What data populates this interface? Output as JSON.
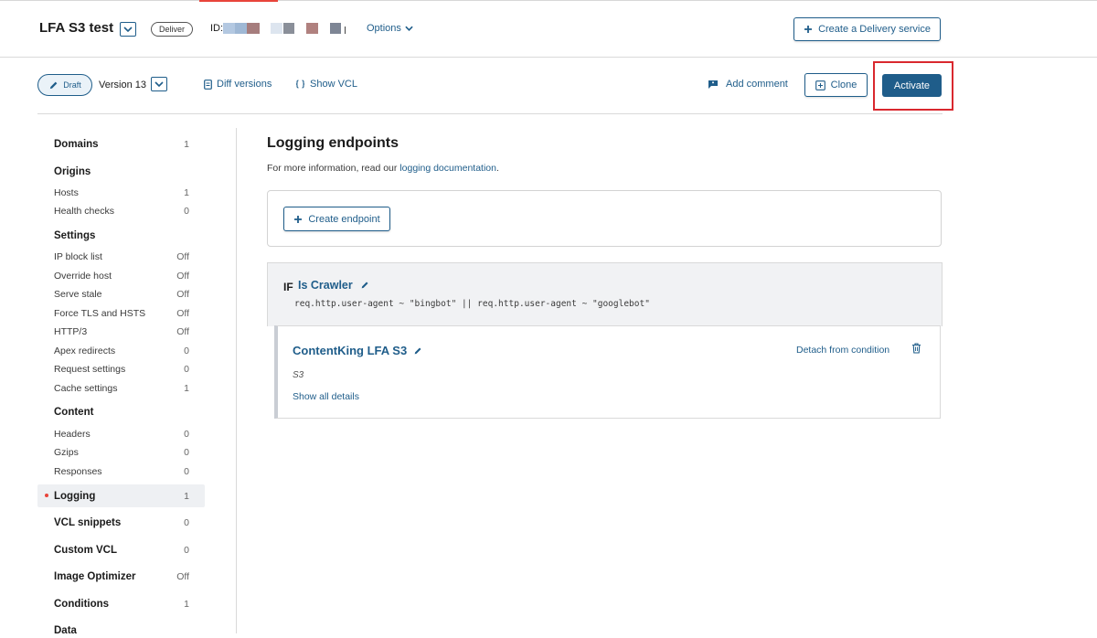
{
  "header": {
    "service_name": "LFA S3 test",
    "service_badge": "Deliver",
    "id_label": "ID:",
    "options_label": "Options",
    "create_service_label": "Create a Delivery service"
  },
  "version_bar": {
    "status_label": "Draft",
    "version_label": "Version 13",
    "diff_label": "Diff versions",
    "show_vcl_label": "Show VCL",
    "add_comment_label": "Add comment",
    "clone_label": "Clone",
    "activate_label": "Activate"
  },
  "sidebar": {
    "domains": {
      "label": "Domains",
      "value": "1"
    },
    "origins": {
      "label": "Origins"
    },
    "hosts": {
      "label": "Hosts",
      "value": "1"
    },
    "health_checks": {
      "label": "Health checks",
      "value": "0"
    },
    "settings": {
      "label": "Settings"
    },
    "ip_block_list": {
      "label": "IP block list",
      "value": "Off"
    },
    "override_host": {
      "label": "Override host",
      "value": "Off"
    },
    "serve_stale": {
      "label": "Serve stale",
      "value": "Off"
    },
    "force_tls": {
      "label": "Force TLS and HSTS",
      "value": "Off"
    },
    "http3": {
      "label": "HTTP/3",
      "value": "Off"
    },
    "apex_redirects": {
      "label": "Apex redirects",
      "value": "0"
    },
    "request_settings": {
      "label": "Request settings",
      "value": "0"
    },
    "cache_settings": {
      "label": "Cache settings",
      "value": "1"
    },
    "content": {
      "label": "Content"
    },
    "headers": {
      "label": "Headers",
      "value": "0"
    },
    "gzips": {
      "label": "Gzips",
      "value": "0"
    },
    "responses": {
      "label": "Responses",
      "value": "0"
    },
    "logging": {
      "label": "Logging",
      "value": "1"
    },
    "vcl_snippets": {
      "label": "VCL snippets",
      "value": "0"
    },
    "custom_vcl": {
      "label": "Custom VCL",
      "value": "0"
    },
    "image_optimizer": {
      "label": "Image Optimizer",
      "value": "Off"
    },
    "conditions": {
      "label": "Conditions",
      "value": "1"
    },
    "data": {
      "label": "Data"
    }
  },
  "main": {
    "title": "Logging endpoints",
    "info_prefix": "For more information, read our ",
    "info_link": "logging documentation",
    "info_suffix": ".",
    "create_endpoint_label": "Create endpoint",
    "condition": {
      "if_label": "IF",
      "name": "Is Crawler",
      "expression": "req.http.user-agent ~ \"bingbot\" || req.http.user-agent ~ \"googlebot\""
    },
    "endpoint": {
      "name": "ContentKing LFA S3",
      "type": "S3",
      "show_details_label": "Show all details",
      "detach_label": "Detach from condition"
    }
  },
  "colors": {
    "accent": "#1f5d8a",
    "highlight": "#d9282e",
    "active_marker": "#e8443a"
  }
}
